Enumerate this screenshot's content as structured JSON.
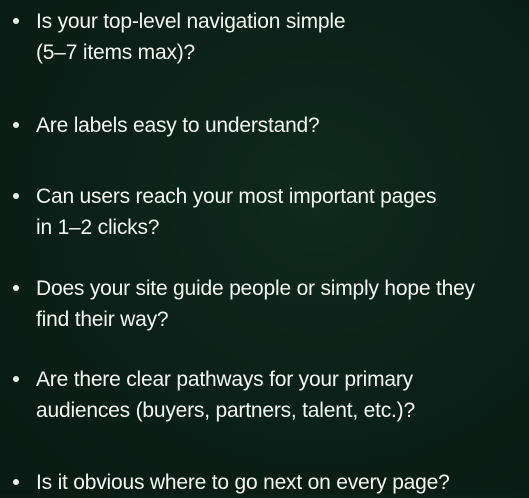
{
  "checklist": {
    "items": [
      {
        "line1": "Is your top-level navigation simple",
        "line2": "(5–7 items max)?"
      },
      {
        "line1": "Are labels easy to understand?",
        "line2": ""
      },
      {
        "line1": "Can users reach your most important pages",
        "line2": "in 1–2 clicks?"
      },
      {
        "line1": "Does your site guide people or simply hope they",
        "line2": "find their way?"
      },
      {
        "line1": "Are there clear pathways for your primary",
        "line2": "audiences (buyers, partners, talent, etc.)?"
      },
      {
        "line1": "Is it obvious where to go next on every page?",
        "line2": ""
      }
    ]
  }
}
